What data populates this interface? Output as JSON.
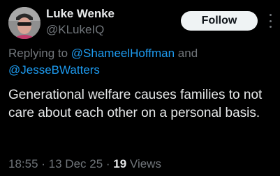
{
  "author": {
    "name": "Luke Wenke",
    "handle": "@KLukeIQ"
  },
  "actions": {
    "follow_label": "Follow",
    "more_icon": "more-dots-vertical-icon"
  },
  "reply": {
    "prefix": "Replying to ",
    "mention1": "@ShameelHoffman",
    "connector": " and",
    "mention2": "@JesseBWatters"
  },
  "tweet": {
    "text": "Generational welfare causes families to not care about each other on a personal basis."
  },
  "meta": {
    "time": "18:55",
    "sep1": " · ",
    "date": "13 Dec 25",
    "sep2": " · ",
    "views_count": "19",
    "views_label": " Views"
  },
  "colors": {
    "background": "#000000",
    "text_primary": "#e7e9ea",
    "text_secondary": "#71767b",
    "link": "#1d9bf0",
    "button_bg": "#eff3f4"
  }
}
